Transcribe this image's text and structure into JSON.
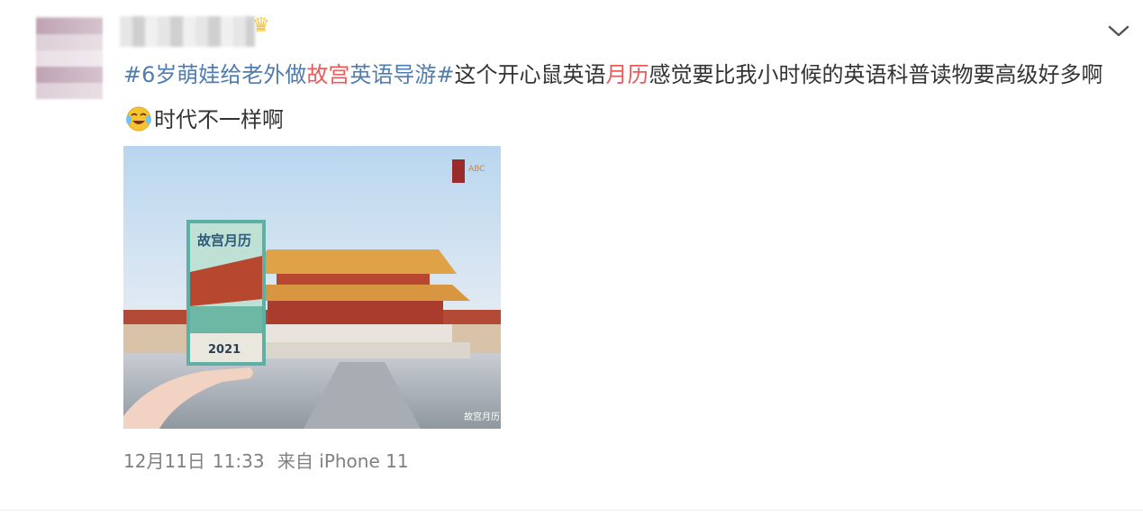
{
  "post": {
    "segments": [
      {
        "text": "#6岁萌娃给老外做",
        "style": "hashtag-blue"
      },
      {
        "text": "故宫",
        "style": "red"
      },
      {
        "text": "英语导游#",
        "style": "hashtag-blue"
      },
      {
        "text": "这个开心鼠英语",
        "style": "normal"
      },
      {
        "text": "月历",
        "style": "red"
      },
      {
        "text": "感觉要比我小时候的英语科普读物要高级好多啊",
        "style": "normal"
      }
    ],
    "after_emoji": "时代不一样啊",
    "emoji_icon": "laughing-crying-emoji-icon"
  },
  "image": {
    "calendar_title": "故宫月历",
    "calendar_year": "2021",
    "watermark": "故宫月历"
  },
  "meta": {
    "date": "12月11日",
    "time": "11:33",
    "source": "来自 iPhone 11"
  },
  "colors": {
    "hashtag": "#507daf",
    "highlight": "#eb5a5a",
    "text": "#333333",
    "meta": "#808080"
  }
}
